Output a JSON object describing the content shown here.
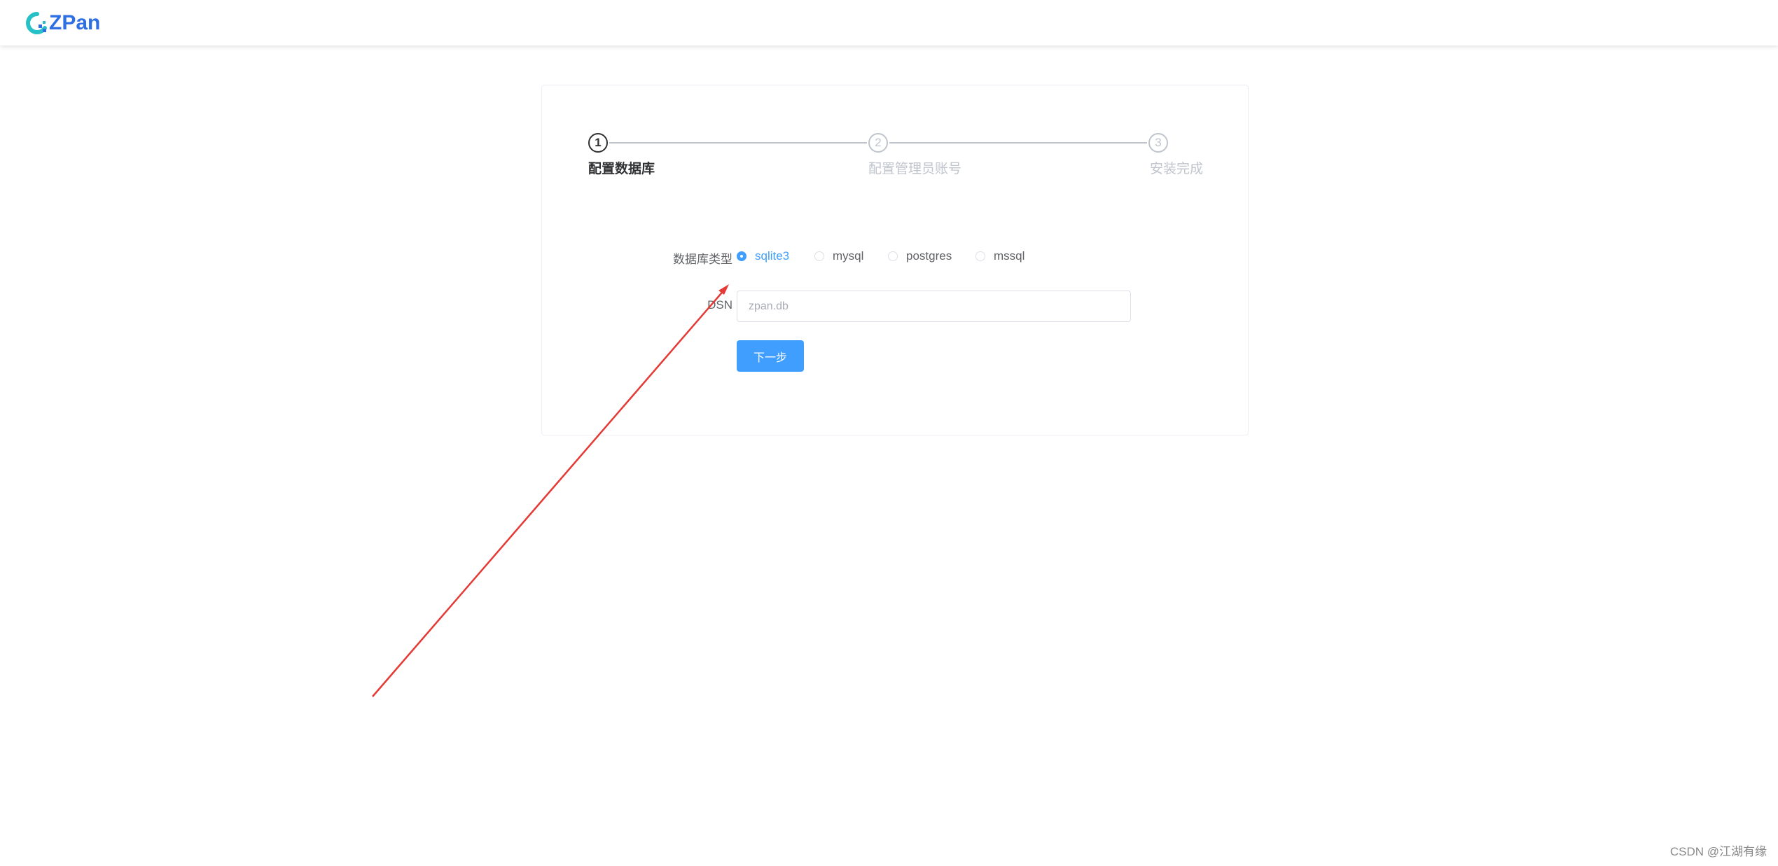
{
  "header": {
    "logo_text": "ZPan",
    "brand_color": "#2f6fe4"
  },
  "steps": {
    "items": [
      {
        "number": "1",
        "title": "配置数据库",
        "status": "active"
      },
      {
        "number": "2",
        "title": "配置管理员账号",
        "status": "wait"
      },
      {
        "number": "3",
        "title": "安装完成",
        "status": "wait"
      }
    ]
  },
  "form": {
    "db_type_label": "数据库类型",
    "db_options": [
      "sqlite3",
      "mysql",
      "postgres",
      "mssql"
    ],
    "db_selected": "sqlite3",
    "dsn_label": "DSN",
    "dsn_placeholder": "zpan.db",
    "dsn_value": "",
    "next_button_label": "下一步"
  },
  "colors": {
    "primary": "#409eff",
    "annotation_arrow": "#e53935"
  },
  "watermark": "CSDN @江湖有缘"
}
